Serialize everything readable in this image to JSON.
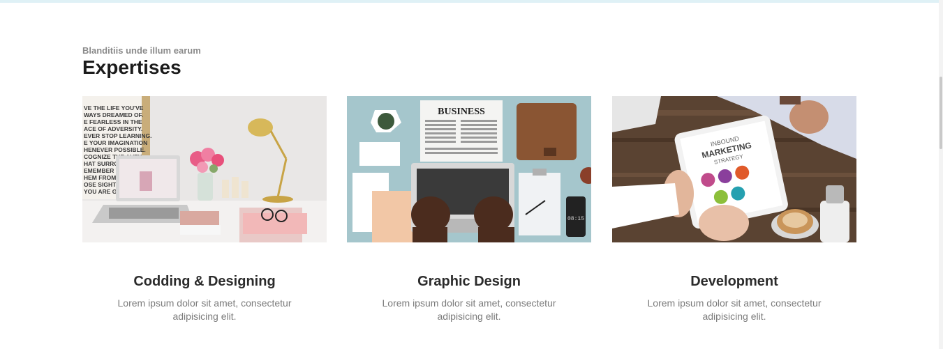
{
  "section": {
    "subtitle": "Blanditiis unde illum earum",
    "title": "Expertises"
  },
  "cards": [
    {
      "title": "Codding & Designing",
      "description": "Lorem ipsum dolor sit amet, consectetur adipisicing elit.",
      "image": "workspace-desk-photo",
      "image_text": [
        "VE THE LIFE YOU'VE",
        "WAYS DREAMED OF.",
        "E FEARLESS IN THE",
        "ACE OF ADVERSITY.",
        "EVER STOP LEARNING.",
        "E YOUR IMAGINATION",
        "HENEVER POSSIBLE.",
        "COGNIZE THE AUTY",
        "HAT SURROUNDS",
        "EMEMBER WHI",
        "HEM FROM. BU",
        "OSE SIGHT OF",
        "YOU ARE GO"
      ]
    },
    {
      "title": "Graphic Design",
      "description": "Lorem ipsum dolor sit amet, consectetur adipisicing elit.",
      "image": "laptop-business-flatlay-photo",
      "image_text": [
        "BUSINESS",
        "08:15"
      ]
    },
    {
      "title": "Development",
      "description": "Lorem ipsum dolor sit amet, consectetur adipisicing elit.",
      "image": "marketing-tablet-photo",
      "image_text": [
        "INBOUND",
        "MARKETING",
        "STRATEGY"
      ]
    }
  ],
  "colors": {
    "topbar": "#dff1f6",
    "title": "#1b1b1b",
    "subtitle": "#8a8a8a",
    "body_text": "#7b7b7b"
  }
}
